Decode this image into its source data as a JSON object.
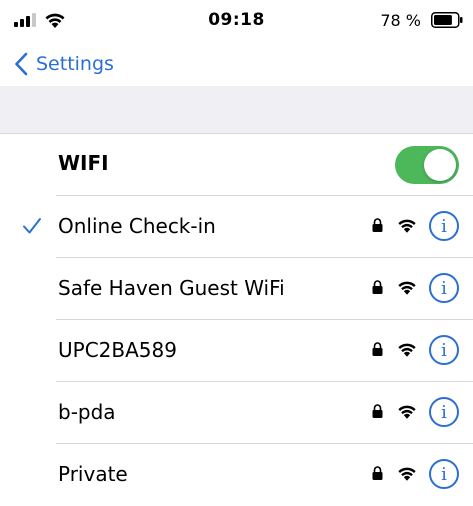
{
  "status_bar": {
    "time": "09:18",
    "battery_percent": "78 %",
    "battery_level": 0.78
  },
  "nav": {
    "back_label": "Settings"
  },
  "wifi": {
    "title": "WIFI",
    "enabled": true,
    "toggle_color": "#4cb85a",
    "networks": [
      {
        "name": "Online Check-in",
        "connected": true,
        "secured": true,
        "info": "i"
      },
      {
        "name": "Safe Haven Guest WiFi",
        "connected": false,
        "secured": true,
        "info": "i"
      },
      {
        "name": "UPC2BA589",
        "connected": false,
        "secured": true,
        "info": "i"
      },
      {
        "name": "b-pda",
        "connected": false,
        "secured": true,
        "info": "i"
      },
      {
        "name": "Private",
        "connected": false,
        "secured": true,
        "info": "i"
      }
    ]
  },
  "colors": {
    "accent": "#2b6fd6",
    "separator": "#d8d8dc",
    "group_background": "#efeff4"
  },
  "icons": {
    "back": "chevron-left-icon",
    "check": "checkmark-icon",
    "lock": "lock-icon",
    "wifi": "wifi-icon",
    "info": "info-icon"
  }
}
